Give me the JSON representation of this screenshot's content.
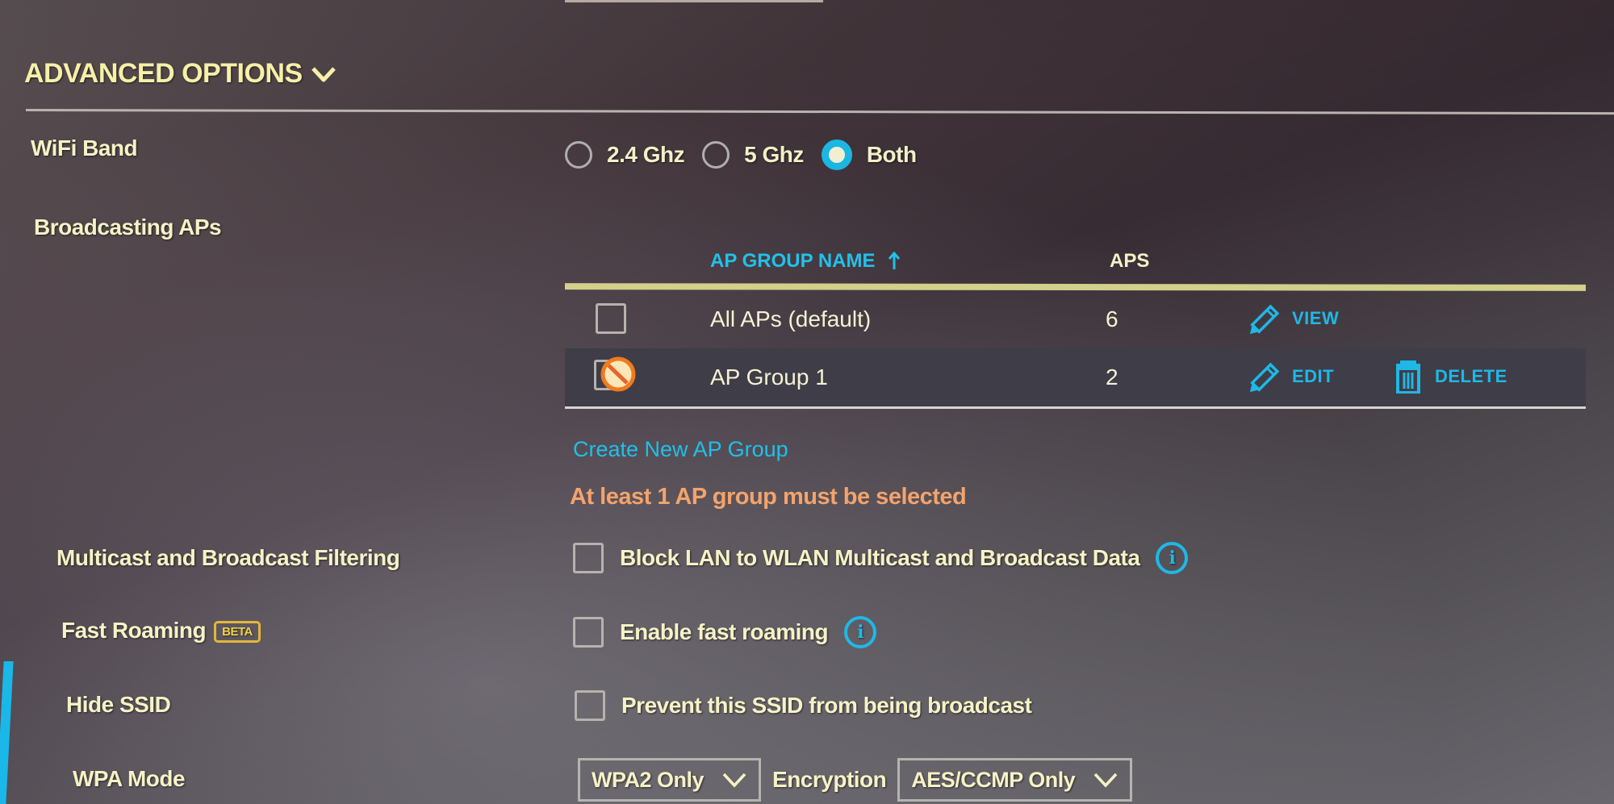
{
  "section": {
    "title": "ADVANCED OPTIONS",
    "expand_icon": "chevron-down-icon"
  },
  "wifi_band": {
    "label": "WiFi Band",
    "options": [
      {
        "label": "2.4 Ghz",
        "checked": false
      },
      {
        "label": "5 Ghz",
        "checked": false
      },
      {
        "label": "Both",
        "checked": true
      }
    ]
  },
  "broadcasting_aps": {
    "label": "Broadcasting APs",
    "columns": {
      "name": "AP GROUP NAME",
      "name_sort_icon": "arrow-up-icon",
      "aps": "APS"
    },
    "rows": [
      {
        "name": "All APs (default)",
        "aps": "6",
        "checked": false,
        "disabled": false,
        "actions": [
          {
            "label": "VIEW",
            "icon": "pencil-icon"
          }
        ]
      },
      {
        "name": "AP Group 1",
        "aps": "2",
        "checked": false,
        "disabled": true,
        "actions": [
          {
            "label": "EDIT",
            "icon": "pencil-icon"
          },
          {
            "label": "DELETE",
            "icon": "trash-icon"
          }
        ]
      }
    ],
    "create_link": "Create New AP Group",
    "error": "At least 1 AP group must be selected"
  },
  "multicast": {
    "label": "Multicast and Broadcast Filtering",
    "checkbox_label": "Block LAN to WLAN Multicast and Broadcast Data",
    "checked": false,
    "info_icon": "i"
  },
  "fast_roaming": {
    "label": "Fast Roaming",
    "badge": "BETA",
    "checkbox_label": "Enable fast roaming",
    "checked": false,
    "info_icon": "i"
  },
  "hide_ssid": {
    "label": "Hide SSID",
    "checkbox_label": "Prevent this SSID from being broadcast",
    "checked": false
  },
  "wpa_mode": {
    "label": "WPA Mode",
    "value": "WPA2 Only",
    "encryption_label": "Encryption",
    "encryption_value": "AES/CCMP Only"
  },
  "colors": {
    "accent": "#1fb8e6",
    "label_text": "#f6f2c6",
    "error": "#f4a36c",
    "table_rule": "#d2d08a",
    "beta_badge": "#e0b83a"
  }
}
